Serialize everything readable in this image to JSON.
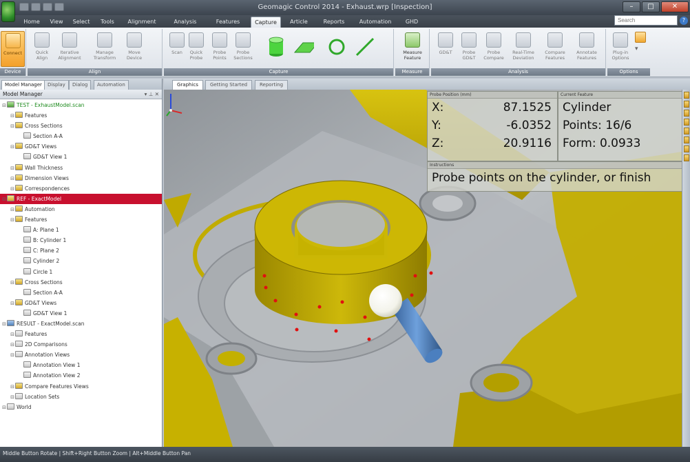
{
  "titlebar": {
    "title": "Geomagic Control 2014 - Exhaust.wrp [Inspection]"
  },
  "ribbon_tabs": [
    "Home",
    "View",
    "Select",
    "Tools",
    "Alignment",
    "Analysis",
    "Features",
    "Capture",
    "Article",
    "Reports",
    "Automation",
    "GHD"
  ],
  "active_tab": "Capture",
  "search": {
    "placeholder": "Search"
  },
  "ribbon": {
    "groups": [
      {
        "title": "Device",
        "buttons": [
          {
            "label": "Connect"
          }
        ]
      },
      {
        "title": "Align",
        "buttons": [
          {
            "label": "Quick Align"
          },
          {
            "label": "Iterative Alignment"
          },
          {
            "label": "Manage Transform"
          },
          {
            "label": "Move Device"
          }
        ]
      },
      {
        "title": "Capture",
        "buttons": [
          {
            "label": "Scan"
          },
          {
            "label": "Quick Probe"
          },
          {
            "label": "Probe Points"
          },
          {
            "label": "Probe Sections"
          }
        ]
      },
      {
        "title": "Measure",
        "buttons": [
          {
            "label": "Measure Feature"
          }
        ]
      },
      {
        "title": "Analysis",
        "buttons": [
          {
            "label": "GD&T"
          },
          {
            "label": "Probe GD&T"
          },
          {
            "label": "Probe Compare"
          },
          {
            "label": "Real-Time Deviation"
          },
          {
            "label": "Compare Features"
          },
          {
            "label": "Annotate Features"
          }
        ]
      },
      {
        "title": "Options",
        "buttons": [
          {
            "label": "Plug-in Options"
          }
        ]
      }
    ]
  },
  "left_panel": {
    "tabs": [
      "Model Manager",
      "Display",
      "Dialog",
      "Automation"
    ],
    "header": "Model Manager",
    "tree": [
      {
        "label": "TEST - ExhaustModel.scan",
        "level": 0,
        "green": true,
        "icon": "green"
      },
      {
        "label": "Features",
        "level": 1,
        "icon": "yellow"
      },
      {
        "label": "Cross Sections",
        "level": 1,
        "icon": "yellow"
      },
      {
        "label": "Section A-A",
        "level": 2,
        "icon": "gray"
      },
      {
        "label": "GD&T Views",
        "level": 1,
        "icon": "yellow"
      },
      {
        "label": "GD&T View 1",
        "level": 2,
        "icon": "gray"
      },
      {
        "label": "Wall Thickness",
        "level": 1,
        "icon": "yellow"
      },
      {
        "label": "Dimension Views",
        "level": 1,
        "icon": "yellow"
      },
      {
        "label": "Correspondences",
        "level": 1,
        "icon": "yellow"
      },
      {
        "label": "REF - ExactModel",
        "level": 0,
        "selected": true,
        "icon": "yellow"
      },
      {
        "label": "Automation",
        "level": 1,
        "icon": "yellow"
      },
      {
        "label": "Features",
        "level": 1,
        "icon": "yellow"
      },
      {
        "label": "A: Plane 1",
        "level": 2,
        "icon": "gray"
      },
      {
        "label": "B: Cylinder 1",
        "level": 2,
        "icon": "gray"
      },
      {
        "label": "C: Plane 2",
        "level": 2,
        "icon": "gray"
      },
      {
        "label": "Cylinder 2",
        "level": 2,
        "icon": "gray"
      },
      {
        "label": "Circle 1",
        "level": 2,
        "icon": "gray"
      },
      {
        "label": "Cross Sections",
        "level": 1,
        "icon": "yellow"
      },
      {
        "label": "Section A-A",
        "level": 2,
        "icon": "gray"
      },
      {
        "label": "GD&T Views",
        "level": 1,
        "icon": "yellow"
      },
      {
        "label": "GD&T View 1",
        "level": 2,
        "icon": "gray"
      },
      {
        "label": "RESULT - ExactModel.scan",
        "level": 0,
        "icon": "blue"
      },
      {
        "label": "Features",
        "level": 1,
        "icon": "gray"
      },
      {
        "label": "2D Comparisons",
        "level": 1,
        "icon": "gray"
      },
      {
        "label": "Annotation Views",
        "level": 1,
        "icon": "gray"
      },
      {
        "label": "Annotation View 1",
        "level": 2,
        "icon": "gray"
      },
      {
        "label": "Annotation View 2",
        "level": 2,
        "icon": "gray"
      },
      {
        "label": "Compare Features Views",
        "level": 1,
        "icon": "yellow"
      },
      {
        "label": "Location Sets",
        "level": 1,
        "icon": "gray"
      },
      {
        "label": "World",
        "level": 0,
        "icon": "gray"
      }
    ]
  },
  "view_tabs": [
    "Graphics",
    "Getting Started",
    "Reporting"
  ],
  "probe_info": {
    "position_header": "Probe Position (mm)",
    "feature_header": "Current Feature",
    "x_label": "X:",
    "x_value": "87.1525",
    "y_label": "Y:",
    "y_value": "-6.0352",
    "z_label": "Z:",
    "z_value": "20.9116",
    "feature_name": "Cylinder",
    "points": "Points: 16/6",
    "form": "Form: 0.0933",
    "prompt_header": "Instructions",
    "prompt": "Probe points on the cylinder, or finish"
  },
  "colors": {
    "cad_yellow": "#c9b400",
    "selected_row": "#c8102e",
    "probe_point": "#e01010",
    "probe_stylus": "#4f86c6"
  },
  "status": {
    "text": "Middle Button Rotate | Shift+Right Button Zoom | Alt+Middle Button Pan"
  }
}
